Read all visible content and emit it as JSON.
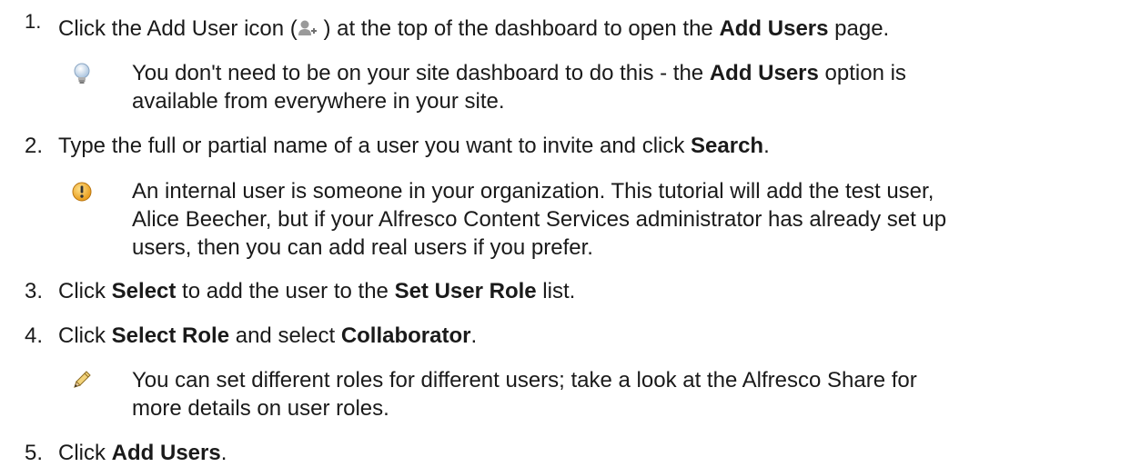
{
  "steps": [
    {
      "number": "1.",
      "parts": [
        "Click the Add User icon (",
        " ) at the top of the dashboard to open the ",
        "Add Users",
        " page."
      ],
      "note": {
        "type": "tip",
        "icon": "lightbulb-icon",
        "lines": [
          [
            "You don't need to be on your site dashboard to do this - the ",
            "Add Users",
            " option is"
          ],
          [
            "available from everywhere in your site."
          ]
        ]
      }
    },
    {
      "number": "2.",
      "parts": [
        "Type the full or partial name of a user you want to invite and click ",
        "Search",
        "."
      ],
      "note": {
        "type": "important",
        "icon": "exclamation-circle-icon",
        "lines": [
          [
            "An internal user is someone in your organization. This tutorial will add the test user,"
          ],
          [
            "Alice Beecher, but if your Alfresco Content Services administrator has already set up"
          ],
          [
            "users, then you can add real users if you prefer."
          ]
        ]
      }
    },
    {
      "number": "3.",
      "parts": [
        "Click ",
        "Select",
        " to add the user to the ",
        "Set User Role",
        " list."
      ]
    },
    {
      "number": "4.",
      "parts": [
        "Click ",
        "Select Role",
        " and select ",
        "Collaborator",
        "."
      ],
      "note": {
        "type": "note",
        "icon": "pencil-icon",
        "lines": [
          [
            "You can set different roles for different users; take a look at the Alfresco Share for"
          ],
          [
            "more details on user roles."
          ]
        ]
      }
    },
    {
      "number": "5.",
      "parts": [
        "Click ",
        "Add Users",
        "."
      ]
    }
  ],
  "icons": {
    "add_user": "add-user-icon",
    "tip_color": "#9bb8d6",
    "important_color": "#f0a020",
    "pencil_color": "#c8a040"
  }
}
